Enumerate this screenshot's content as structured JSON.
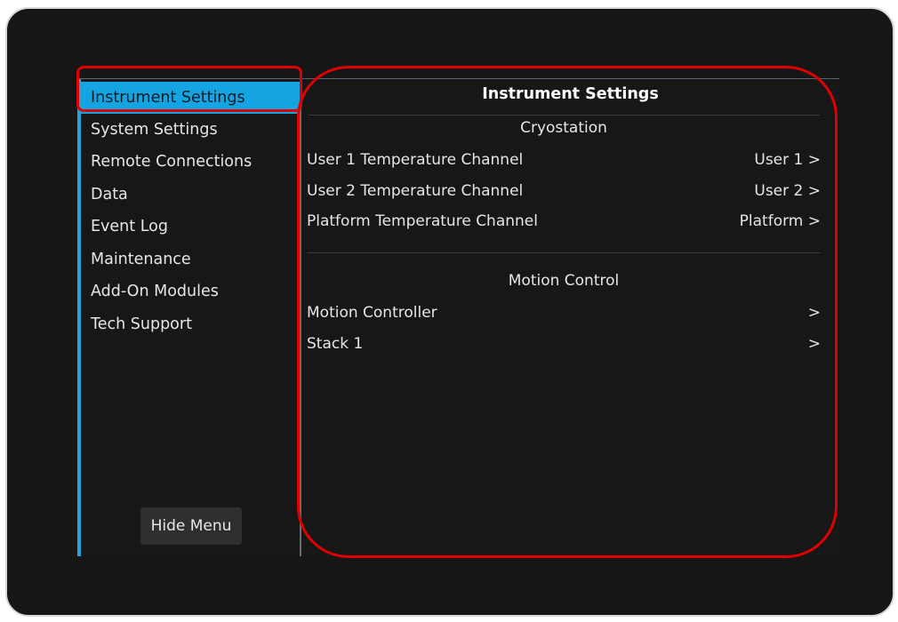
{
  "sidebar": {
    "items": [
      {
        "label": "Instrument Settings",
        "active": true
      },
      {
        "label": "System Settings"
      },
      {
        "label": "Remote Connections"
      },
      {
        "label": "Data"
      },
      {
        "label": "Event Log"
      },
      {
        "label": "Maintenance"
      },
      {
        "label": "Add-On Modules"
      },
      {
        "label": "Tech Support"
      }
    ],
    "hide_menu_label": "Hide Menu"
  },
  "content": {
    "title": "Instrument Settings",
    "sections": [
      {
        "header": "Cryostation",
        "rows": [
          {
            "label": "User 1 Temperature Channel",
            "value": "User 1 >"
          },
          {
            "label": "User 2 Temperature Channel",
            "value": "User 2 >"
          },
          {
            "label": "Platform Temperature Channel",
            "value": "Platform >"
          }
        ]
      },
      {
        "header": "Motion Control",
        "rows": [
          {
            "label": "Motion Controller",
            "value": ">"
          },
          {
            "label": "Stack 1",
            "value": ">"
          }
        ]
      }
    ]
  },
  "colors": {
    "accent": "#14a4e1",
    "annotation": "#e10000",
    "background": "#171717"
  }
}
